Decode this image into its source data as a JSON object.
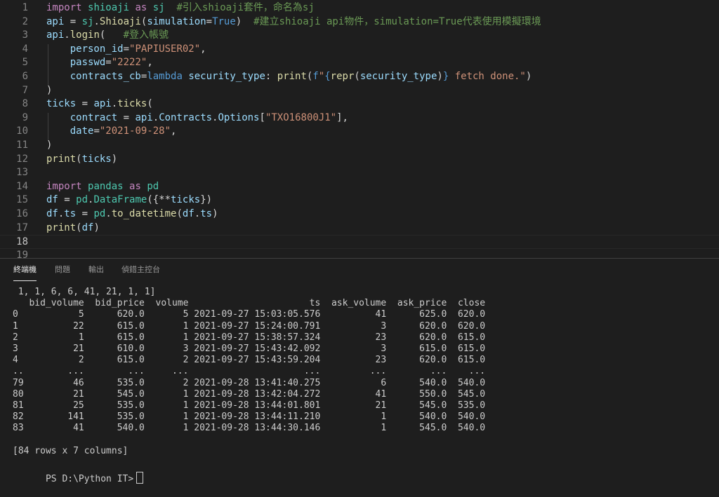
{
  "editor": {
    "lines": [
      {
        "no": "1",
        "tokens": [
          [
            "k",
            "import"
          ],
          [
            "p",
            " "
          ],
          [
            "m",
            "shioaji"
          ],
          [
            "p",
            " "
          ],
          [
            "k",
            "as"
          ],
          [
            "p",
            " "
          ],
          [
            "m",
            "sj"
          ],
          [
            "p",
            "  "
          ],
          [
            "c",
            "#引入shioaji套件，命名為sj"
          ]
        ]
      },
      {
        "no": "2",
        "tokens": [
          [
            "v",
            "api"
          ],
          [
            "p",
            " = "
          ],
          [
            "m",
            "sj"
          ],
          [
            "p",
            "."
          ],
          [
            "f",
            "Shioaji"
          ],
          [
            "p",
            "("
          ],
          [
            "v",
            "simulation"
          ],
          [
            "p",
            "="
          ],
          [
            "kw",
            "True"
          ],
          [
            "p",
            ")  "
          ],
          [
            "c",
            "#建立shioaji api物件，simulation=True代表使用模擬環境"
          ]
        ]
      },
      {
        "no": "3",
        "tokens": [
          [
            "v",
            "api"
          ],
          [
            "p",
            "."
          ],
          [
            "f",
            "login"
          ],
          [
            "p",
            "(   "
          ],
          [
            "c",
            "#登入帳號"
          ]
        ]
      },
      {
        "no": "4",
        "tokens": [
          [
            "p",
            "    "
          ],
          [
            "v",
            "person_id"
          ],
          [
            "p",
            "="
          ],
          [
            "s",
            "\"PAPIUSER02\""
          ],
          [
            "p",
            ","
          ]
        ]
      },
      {
        "no": "5",
        "tokens": [
          [
            "p",
            "    "
          ],
          [
            "v",
            "passwd"
          ],
          [
            "p",
            "="
          ],
          [
            "s",
            "\"2222\""
          ],
          [
            "p",
            ","
          ]
        ]
      },
      {
        "no": "6",
        "tokens": [
          [
            "p",
            "    "
          ],
          [
            "v",
            "contracts_cb"
          ],
          [
            "p",
            "="
          ],
          [
            "kw",
            "lambda"
          ],
          [
            "p",
            " "
          ],
          [
            "v",
            "security_type"
          ],
          [
            "p",
            ": "
          ],
          [
            "f",
            "print"
          ],
          [
            "p",
            "("
          ],
          [
            "kw",
            "f"
          ],
          [
            "s",
            "\""
          ],
          [
            "kw",
            "{"
          ],
          [
            "f",
            "repr"
          ],
          [
            "p",
            "("
          ],
          [
            "v",
            "security_type"
          ],
          [
            "p",
            ")"
          ],
          [
            "kw",
            "}"
          ],
          [
            "s",
            " fetch done.\""
          ],
          [
            "p",
            ")"
          ]
        ]
      },
      {
        "no": "7",
        "tokens": [
          [
            "p",
            ")"
          ]
        ]
      },
      {
        "no": "8",
        "tokens": [
          [
            "v",
            "ticks"
          ],
          [
            "p",
            " = "
          ],
          [
            "v",
            "api"
          ],
          [
            "p",
            "."
          ],
          [
            "f",
            "ticks"
          ],
          [
            "p",
            "("
          ]
        ]
      },
      {
        "no": "9",
        "tokens": [
          [
            "p",
            "    "
          ],
          [
            "v",
            "contract"
          ],
          [
            "p",
            " = "
          ],
          [
            "v",
            "api"
          ],
          [
            "p",
            "."
          ],
          [
            "v",
            "Contracts"
          ],
          [
            "p",
            "."
          ],
          [
            "v",
            "Options"
          ],
          [
            "p",
            "["
          ],
          [
            "s",
            "\"TXO16800J1\""
          ],
          [
            "p",
            "],"
          ]
        ]
      },
      {
        "no": "10",
        "tokens": [
          [
            "p",
            "    "
          ],
          [
            "v",
            "date"
          ],
          [
            "p",
            "="
          ],
          [
            "s",
            "\"2021-09-28\""
          ],
          [
            "p",
            ","
          ]
        ]
      },
      {
        "no": "11",
        "tokens": [
          [
            "p",
            ")"
          ]
        ]
      },
      {
        "no": "12",
        "tokens": [
          [
            "f",
            "print"
          ],
          [
            "p",
            "("
          ],
          [
            "v",
            "ticks"
          ],
          [
            "p",
            ")"
          ]
        ]
      },
      {
        "no": "13",
        "tokens": []
      },
      {
        "no": "14",
        "tokens": [
          [
            "k",
            "import"
          ],
          [
            "p",
            " "
          ],
          [
            "m",
            "pandas"
          ],
          [
            "p",
            " "
          ],
          [
            "k",
            "as"
          ],
          [
            "p",
            " "
          ],
          [
            "m",
            "pd"
          ]
        ]
      },
      {
        "no": "15",
        "tokens": [
          [
            "v",
            "df"
          ],
          [
            "p",
            " = "
          ],
          [
            "m",
            "pd"
          ],
          [
            "p",
            "."
          ],
          [
            "m",
            "DataFrame"
          ],
          [
            "p",
            "({**"
          ],
          [
            "v",
            "ticks"
          ],
          [
            "p",
            "})"
          ]
        ]
      },
      {
        "no": "16",
        "tokens": [
          [
            "v",
            "df"
          ],
          [
            "p",
            "."
          ],
          [
            "v",
            "ts"
          ],
          [
            "p",
            " = "
          ],
          [
            "m",
            "pd"
          ],
          [
            "p",
            "."
          ],
          [
            "f",
            "to_datetime"
          ],
          [
            "p",
            "("
          ],
          [
            "v",
            "df"
          ],
          [
            "p",
            "."
          ],
          [
            "v",
            "ts"
          ],
          [
            "p",
            ")"
          ]
        ]
      },
      {
        "no": "17",
        "tokens": [
          [
            "f",
            "print"
          ],
          [
            "p",
            "("
          ],
          [
            "v",
            "df"
          ],
          [
            "p",
            ")"
          ]
        ]
      },
      {
        "no": "18",
        "tokens": []
      },
      {
        "no": "19",
        "tokens": []
      }
    ]
  },
  "panel": {
    "tabs": [
      {
        "label": "終端機",
        "active": true
      },
      {
        "label": "問題",
        "active": false
      },
      {
        "label": "輸出",
        "active": false
      },
      {
        "label": "偵錯主控台",
        "active": false
      }
    ]
  },
  "terminal": {
    "lines": [
      " 1, 1, 6, 6, 41, 21, 1, 1]",
      "   bid_volume  bid_price  volume                      ts  ask_volume  ask_price  close",
      "0           5      620.0       5 2021-09-27 15:03:05.576          41      625.0  620.0",
      "1          22      615.0       1 2021-09-27 15:24:00.791           3      620.0  620.0",
      "2           1      615.0       1 2021-09-27 15:38:57.324          23      620.0  615.0",
      "3          21      610.0       3 2021-09-27 15:43:42.092           3      615.0  615.0",
      "4           2      615.0       2 2021-09-27 15:43:59.204          23      620.0  615.0",
      "..        ...        ...     ...                     ...         ...        ...    ...",
      "79         46      535.0       2 2021-09-28 13:41:40.275           6      540.0  540.0",
      "80         21      545.0       1 2021-09-28 13:42:04.272          41      550.0  545.0",
      "81         25      535.0       1 2021-09-28 13:44:01.801          21      545.0  535.0",
      "82        141      535.0       1 2021-09-28 13:44:11.210           1      540.0  540.0",
      "83         41      540.0       1 2021-09-28 13:44:30.146           1      545.0  540.0",
      "",
      "[84 rows x 7 columns]"
    ],
    "prompt": "PS D:\\Python IT>"
  }
}
